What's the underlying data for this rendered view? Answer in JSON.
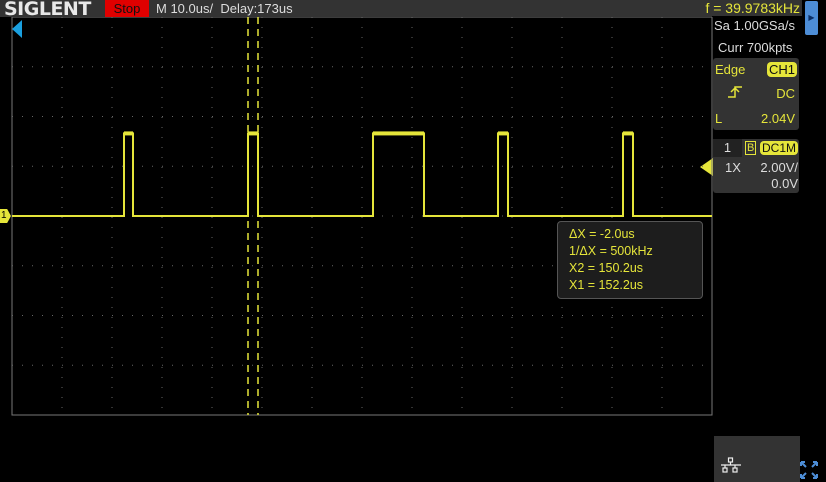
{
  "header": {
    "logo": "SIGLENT",
    "run_state": "Stop",
    "timebase": "M 10.0us/",
    "delay": "Delay:173us",
    "frequency": "f = 39.9783kHz"
  },
  "acquisition": {
    "sample_rate": "Sa 1.00GSa/s",
    "memory": "Curr 700kpts"
  },
  "trigger": {
    "type": "Edge",
    "source": "CH1",
    "coupling": "DC",
    "level_label": "L",
    "level": "2.04V",
    "slope_icon": "rising-edge-icon"
  },
  "channel": {
    "number": "1",
    "bandwidth_limit": "B",
    "coupling": "DC1M",
    "probe": "1X",
    "scale": "2.00V/",
    "offset": "0.0V",
    "marker": "1"
  },
  "cursors": {
    "delta_x": "ΔX = -2.0us",
    "inv_delta_x": "1/ΔX = 500kHz",
    "x2": "X2 = 150.2us",
    "x1": "X1 = 152.2us"
  },
  "colors": {
    "ch1": "#e5e53a",
    "stop": "#e00000",
    "accent": "#4d8dd6"
  },
  "waveform": {
    "pulses_div": [
      [
        2.24,
        2.42
      ],
      [
        4.72,
        4.92
      ],
      [
        7.22,
        8.24
      ],
      [
        9.72,
        9.92
      ],
      [
        12.22,
        12.42
      ]
    ],
    "cursor_div": [
      4.72,
      4.92
    ],
    "low_div": 0,
    "high_div": 1.66
  }
}
